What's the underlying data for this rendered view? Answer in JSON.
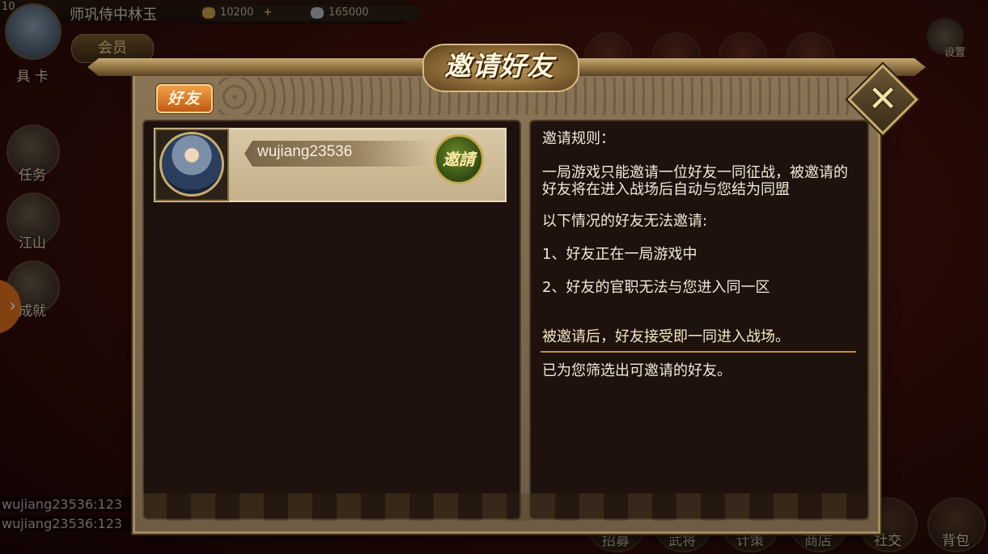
{
  "hud": {
    "level": "10",
    "player_name": "师巩侍中林玉",
    "gold": "10200",
    "silver": "165000",
    "member_label": "会员",
    "avatar_label": "具 卡",
    "settings_label": "设置",
    "side_menu": [
      "任务",
      "江山",
      "成就"
    ],
    "bottom_menu": [
      "招募",
      "武将",
      "计策",
      "商店",
      "社交",
      "背包"
    ],
    "chat_lines": [
      "wujiang23536:123",
      "wujiang23536:123"
    ]
  },
  "dialog": {
    "title": "邀请好友",
    "tab_friends": "好友",
    "close_symbol": "✕",
    "friends": [
      {
        "name": "wujiang23536",
        "invite_label": "邀請"
      }
    ],
    "rules": {
      "heading": "邀请规则：",
      "line1": "一局游戏只能邀请一位好友一同征战，被邀请的好友将在进入战场后自动与您结为同盟",
      "condition_heading": "以下情况的好友无法邀请:",
      "condition1": "1、好友正在一局游戏中",
      "condition2": "2、好友的官职无法与您进入同一区",
      "after_invite": "被邀请后，好友接受即一同进入战场。",
      "filtered_note": "已为您筛选出可邀请的好友。"
    }
  },
  "colors": {
    "tab_accent": "#e07a22",
    "divider": "#c2902e",
    "invite_button": "#4a6a1e",
    "panel_bg": "#1d120d"
  }
}
